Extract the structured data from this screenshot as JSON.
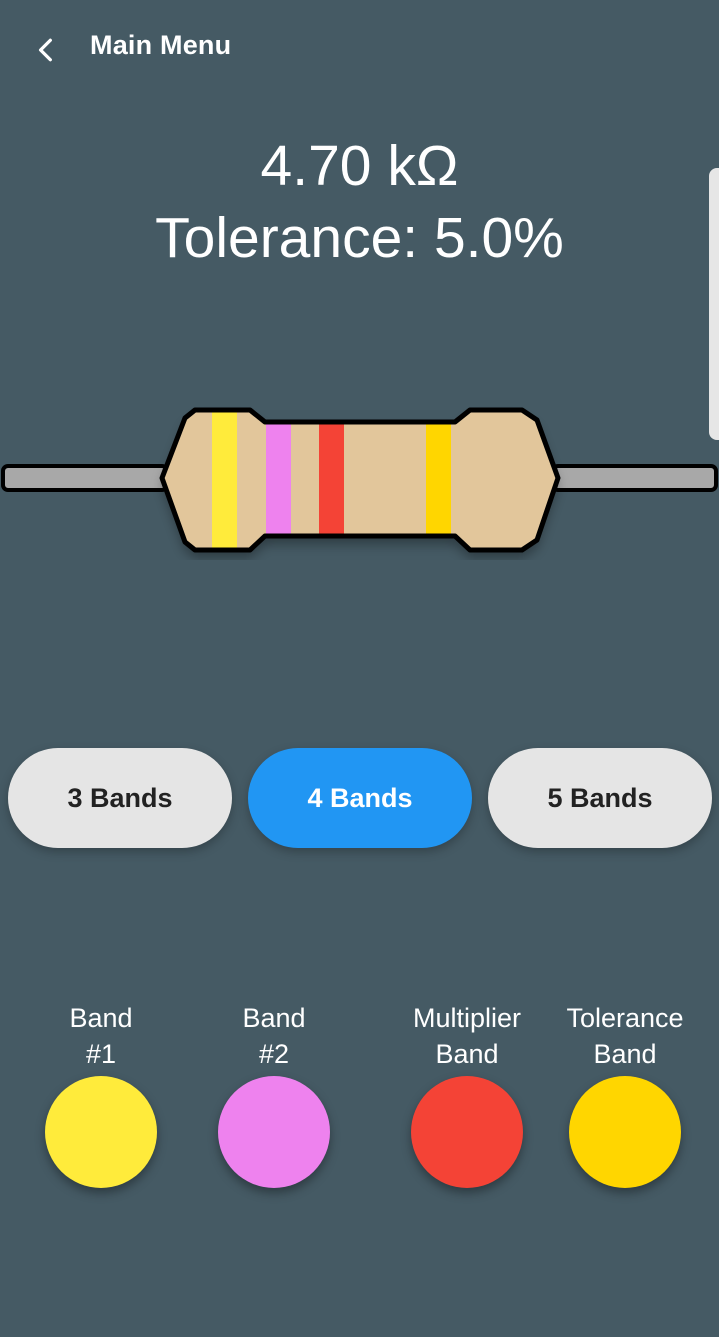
{
  "header": {
    "title": "Main Menu",
    "back_icon": "chevron-left-icon"
  },
  "result": {
    "resistance": "4.70 kΩ",
    "tolerance": "Tolerance: 5.0%"
  },
  "resistor": {
    "body_color": "#e2c69b",
    "lead_color": "#a8a8a8",
    "outline_color": "#000000",
    "bands": [
      {
        "name": "band-1",
        "color": "#ffeb3b"
      },
      {
        "name": "band-2",
        "color": "#ee82ee"
      },
      {
        "name": "multiplier",
        "color": "#f44336"
      },
      {
        "name": "tolerance",
        "color": "#ffd600"
      }
    ]
  },
  "band_types": {
    "options": [
      {
        "label": "3 Bands",
        "selected": false
      },
      {
        "label": "4 Bands",
        "selected": true
      },
      {
        "label": "5 Bands",
        "selected": false
      }
    ],
    "active_color": "#2196f3",
    "inactive_color": "#e5e5e5"
  },
  "pickers": [
    {
      "label_line1": "Band",
      "label_line2": "#1",
      "color": "#ffeb3b"
    },
    {
      "label_line1": "Band",
      "label_line2": "#2",
      "color": "#ee82ee"
    },
    {
      "label_line1": "Multiplier",
      "label_line2": "Band",
      "color": "#f44336"
    },
    {
      "label_line1": "Tolerance",
      "label_line2": "Band",
      "color": "#ffd600"
    }
  ],
  "colors": {
    "background": "#455a64",
    "text": "#ffffff"
  }
}
